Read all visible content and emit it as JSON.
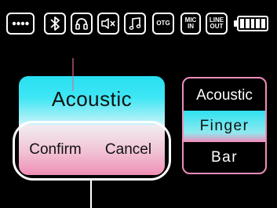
{
  "status_bar": {
    "icons": [
      {
        "name": "menu-dots-icon"
      },
      {
        "name": "bluetooth-icon"
      },
      {
        "name": "headphone-icon"
      },
      {
        "name": "mute-icon"
      },
      {
        "name": "music-note-icon"
      },
      {
        "name": "otg-icon",
        "label": "OTG"
      },
      {
        "name": "mic-in-icon",
        "line1": "MIC",
        "line2": "IN"
      },
      {
        "name": "line-out-icon",
        "line1": "LINE",
        "line2": "OUT"
      }
    ],
    "battery": {
      "level": 1.0,
      "cells": 5
    }
  },
  "popup": {
    "title": "Acoustic",
    "confirm_label": "Confirm",
    "cancel_label": "Cancel"
  },
  "mode_list": {
    "items": [
      {
        "label": "Acoustic",
        "selected": false
      },
      {
        "label": "Finger",
        "selected": true
      },
      {
        "label": "Bar",
        "selected": false
      }
    ]
  },
  "colors": {
    "background": "#000000",
    "accent_cyan": "#27e0f2",
    "accent_pink": "#f08cbb"
  }
}
